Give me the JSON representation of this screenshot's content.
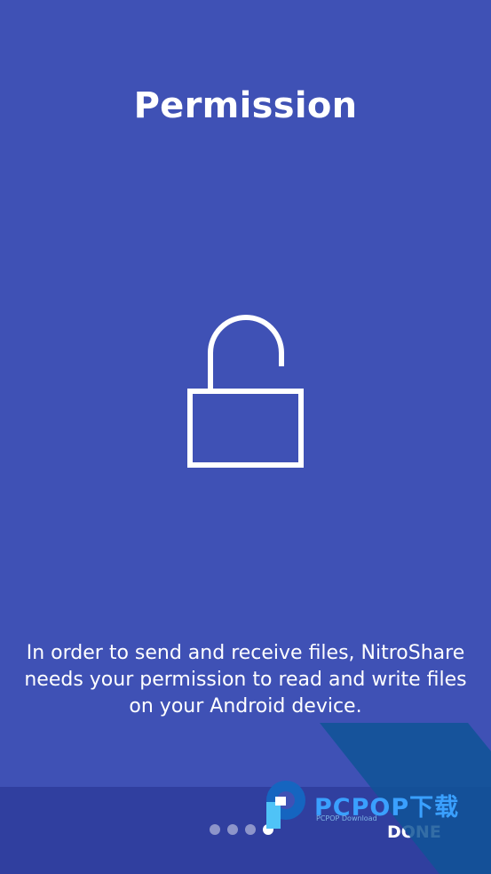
{
  "screen": {
    "title": "Permission",
    "description": "In order to send and receive files, NitroShare needs your permission to read and write files on your Android device.",
    "icon": "unlocked-padlock-icon"
  },
  "pager": {
    "count": 4,
    "active_index": 3
  },
  "actions": {
    "done_label": "DONE"
  },
  "watermark": {
    "brand": "PCPOP下载",
    "subtitle": "PCPOP Download"
  },
  "colors": {
    "background": "#3f51b5",
    "bottom_bar": "#303f9f",
    "foreground": "#ffffff"
  }
}
